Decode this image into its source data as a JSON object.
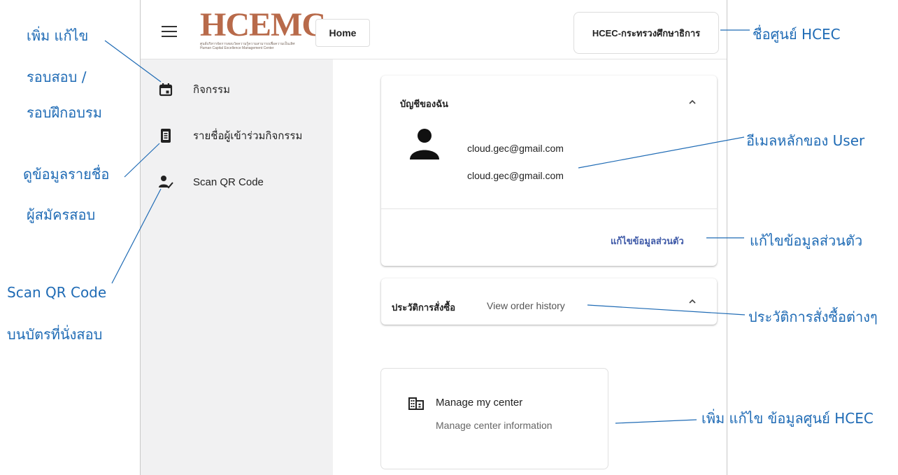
{
  "header": {
    "logo_text": "HCEMC",
    "logo_sub1": "ศูนย์บริหารจัดการสอบวัดความรู้ความสามารถเพื่อความเป็นเลิศ",
    "logo_sub2": "Human Capital Excellence Management Center",
    "home_label": "Home",
    "center_label": "HCEC-กระทรวงศึกษาธิการ"
  },
  "sidebar": {
    "items": [
      {
        "label": "กิจกรรม",
        "icon": "calendar-icon"
      },
      {
        "label": "รายชื่อผู้เข้าร่วมกิจกรรม",
        "icon": "list-icon"
      },
      {
        "label": "Scan QR Code",
        "icon": "person-check-icon"
      }
    ]
  },
  "account": {
    "title": "บัญชีของฉัน",
    "email_primary": "cloud.gec@gmail.com",
    "email_secondary": "cloud.gec@gmail.com",
    "edit_label": "แก้ไขข้อมูลส่วนตัว"
  },
  "orders": {
    "title": "ประวัติการสั่งซื้อ",
    "subtitle": "View order history"
  },
  "manage": {
    "title": "Manage my center",
    "subtitle": "Manage center information"
  },
  "annotations": {
    "edit_round_1": "เพิ่ม แก้ไข",
    "edit_round_2": "รอบสอบ /",
    "edit_round_3": "รอบฝึกอบรม",
    "view_list_1": "ดูข้อมูลรายชื่อ",
    "view_list_2": "ผู้สมัครสอบ",
    "scan_1": "Scan QR Code",
    "scan_2": "บนบัตรที่นั่งสอบ",
    "center_name": "ชื่อศูนย์ HCEC",
    "main_email": "อีเมลหลักของ User",
    "edit_profile": "แก้ไขข้อมูลส่วนตัว",
    "order_history": "ประวัติการสั่งซื้อต่างๆ",
    "edit_center": "เพิ่ม แก้ไข ข้อมูลศูนย์ HCEC"
  },
  "colors": {
    "annotation": "#1f6bb5",
    "link": "#3f5aa8",
    "logo": "#b86a4a",
    "sidebar_bg": "#f1f1f2"
  }
}
